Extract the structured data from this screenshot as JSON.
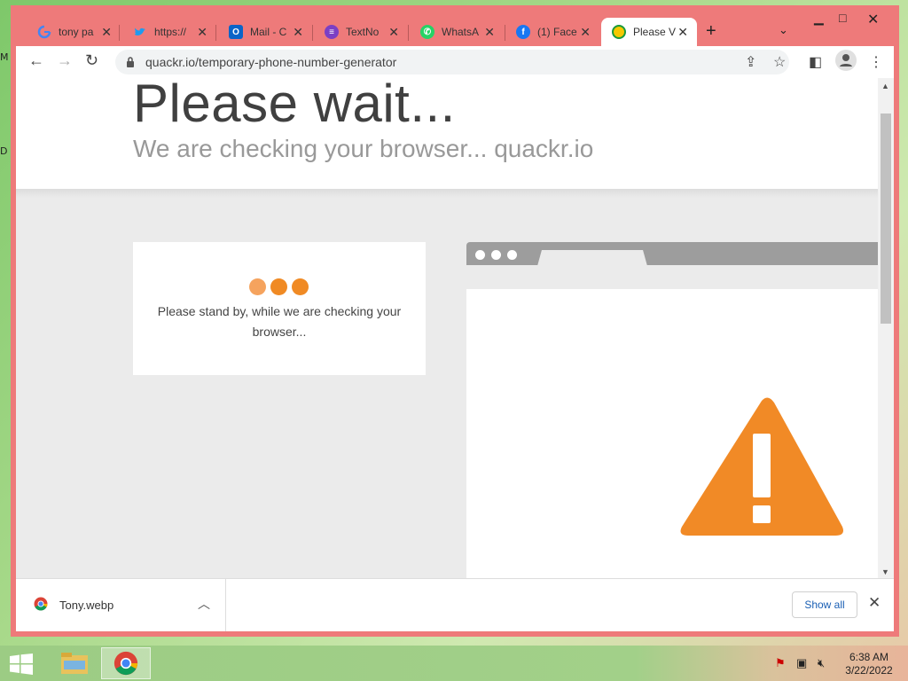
{
  "desktop": {
    "glyph_1": "M",
    "glyph_2": "D"
  },
  "browser": {
    "tabs": [
      {
        "title": "tony pa",
        "favicon": "google-icon"
      },
      {
        "title": "https://",
        "favicon": "twitter-icon"
      },
      {
        "title": "Mail - C",
        "favicon": "outlook-icon"
      },
      {
        "title": "TextNo",
        "favicon": "textnow-icon"
      },
      {
        "title": "WhatsA",
        "favicon": "whatsapp-icon"
      },
      {
        "title": "(1) Face",
        "favicon": "facebook-icon"
      },
      {
        "title": "Please V",
        "favicon": "quackr-icon",
        "active": true
      }
    ],
    "url": "quackr.io/temporary-phone-number-generator"
  },
  "page": {
    "heading": "Please wait...",
    "subheading": "We are checking your browser... quackr.io",
    "card_message": "Please stand by, while we are checking your browser...",
    "colors": {
      "dot1": "#f4a460",
      "dot2": "#f08a24",
      "dot3": "#f08a24",
      "warning": "#f18a26"
    }
  },
  "downloads": {
    "file_name": "Tony.webp",
    "show_all_label": "Show all"
  },
  "taskbar": {
    "time": "6:38 AM",
    "date": "3/22/2022"
  }
}
